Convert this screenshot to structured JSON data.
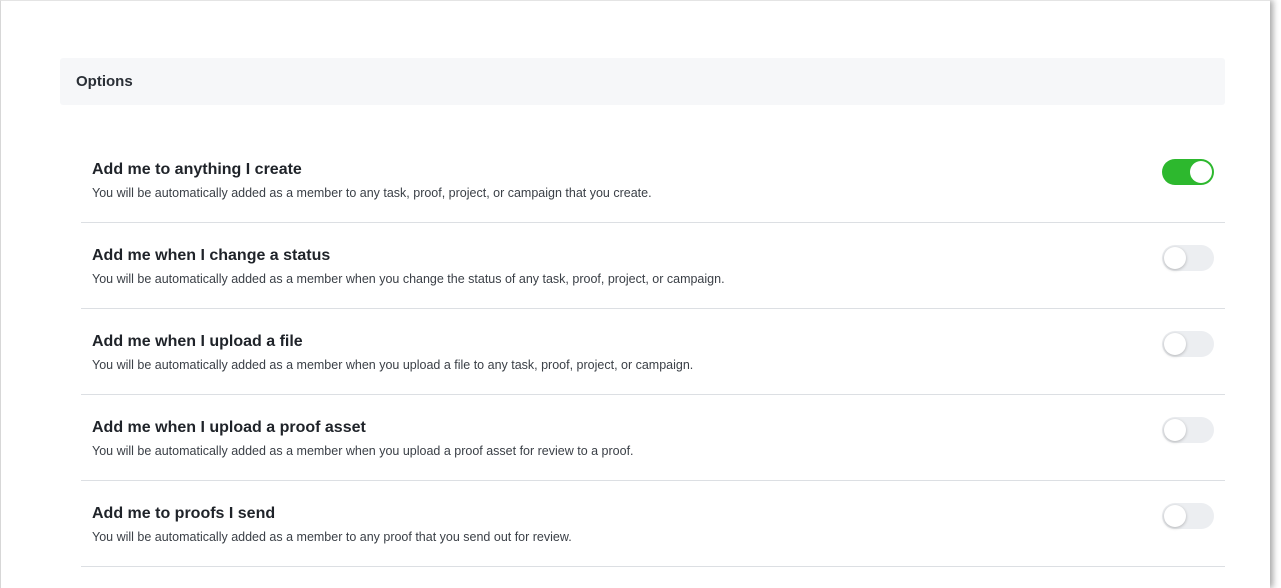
{
  "section": {
    "title": "Options"
  },
  "options": [
    {
      "title": "Add me to anything I create",
      "description": "You will be automatically added as a member to any task, proof, project, or campaign that you create.",
      "enabled": true
    },
    {
      "title": "Add me when I change a status",
      "description": "You will be automatically added as a member when you change the status of any task, proof, project, or campaign.",
      "enabled": false
    },
    {
      "title": "Add me when I upload a file",
      "description": "You will be automatically added as a member when you upload a file to any task, proof, project, or campaign.",
      "enabled": false
    },
    {
      "title": "Add me when I upload a proof asset",
      "description": "You will be automatically added as a member when you upload a proof asset for review to a proof.",
      "enabled": false
    },
    {
      "title": "Add me to proofs I send",
      "description": "You will be automatically added as a member to any proof that you send out for review.",
      "enabled": false
    }
  ],
  "colors": {
    "toggle_on": "#2db82e",
    "toggle_off": "#eceef1",
    "header_bg": "#f6f7f9"
  }
}
